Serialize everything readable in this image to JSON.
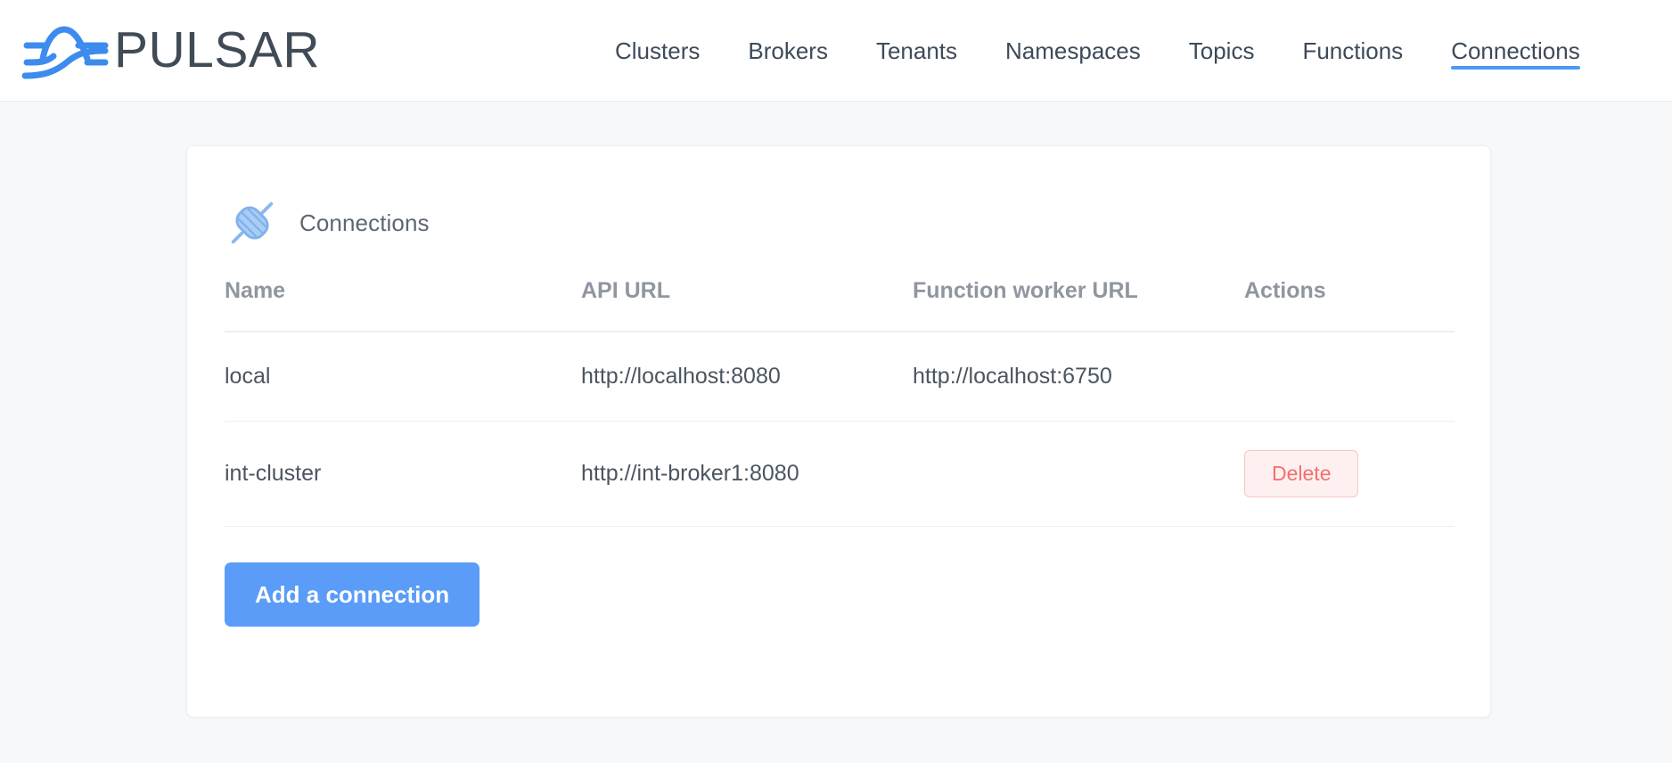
{
  "header": {
    "brand_name": "PULSAR",
    "logo_icon": "pulsar-wave-logo",
    "nav": [
      {
        "label": "Clusters",
        "active": false
      },
      {
        "label": "Brokers",
        "active": false
      },
      {
        "label": "Tenants",
        "active": false
      },
      {
        "label": "Namespaces",
        "active": false
      },
      {
        "label": "Topics",
        "active": false
      },
      {
        "label": "Functions",
        "active": false
      },
      {
        "label": "Connections",
        "active": true
      }
    ]
  },
  "card": {
    "icon": "plug-connector-icon",
    "title": "Connections",
    "table": {
      "columns": [
        "Name",
        "API URL",
        "Function worker URL",
        "Actions"
      ],
      "rows": [
        {
          "name": "local",
          "api_url": "http://localhost:8080",
          "function_worker_url": "http://localhost:6750",
          "action_label": ""
        },
        {
          "name": "int-cluster",
          "api_url": "http://int-broker1:8080",
          "function_worker_url": "",
          "action_label": "Delete"
        }
      ]
    },
    "add_button_label": "Add a connection"
  },
  "colors": {
    "accent": "#4a9bf5",
    "primary_button": "#5a9cf7",
    "danger_text": "#f2706f",
    "danger_bg": "#fef0f0",
    "danger_border": "#fbc4c4",
    "page_bg": "#f7f8fa",
    "card_bg": "#ffffff",
    "divider": "#ebeef5",
    "header_text": "#3d4a59",
    "muted_text": "#9096a0"
  }
}
